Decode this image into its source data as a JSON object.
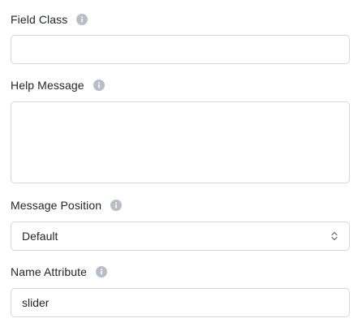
{
  "fields": {
    "field_class": {
      "label": "Field Class",
      "value": "",
      "info_icon": "info-icon"
    },
    "help_message": {
      "label": "Help Message",
      "value": "",
      "info_icon": "info-icon"
    },
    "message_position": {
      "label": "Message Position",
      "selected": "Default",
      "info_icon": "info-icon",
      "dropdown_icon": "chevron-updown-icon"
    },
    "name_attribute": {
      "label": "Name Attribute",
      "value": "slider",
      "info_icon": "info-icon"
    }
  },
  "colors": {
    "info_icon_bg": "#b8bec6",
    "border": "#d4d8dd",
    "text": "#1f2328"
  }
}
